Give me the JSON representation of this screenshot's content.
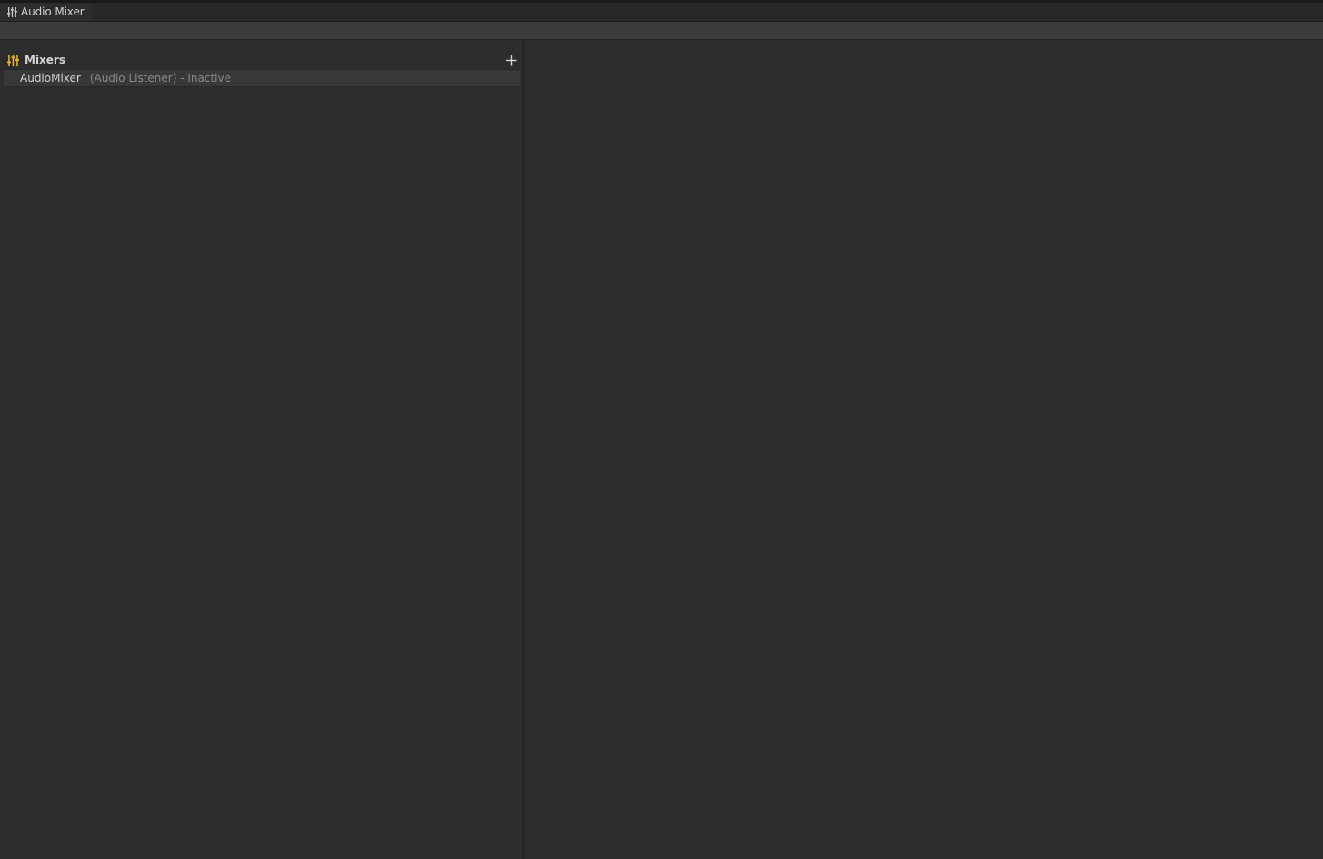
{
  "window": {
    "tab_title": "Audio Mixer",
    "tab_icon": "mixer-sliders-icon"
  },
  "mixers_panel": {
    "title": "Mixers",
    "title_icon": "mixer-sliders-icon",
    "add_icon": "plus-icon",
    "accent_color": "#f0b820",
    "items": [
      {
        "name": "AudioMixer",
        "status": "(Audio Listener) - Inactive"
      }
    ]
  }
}
